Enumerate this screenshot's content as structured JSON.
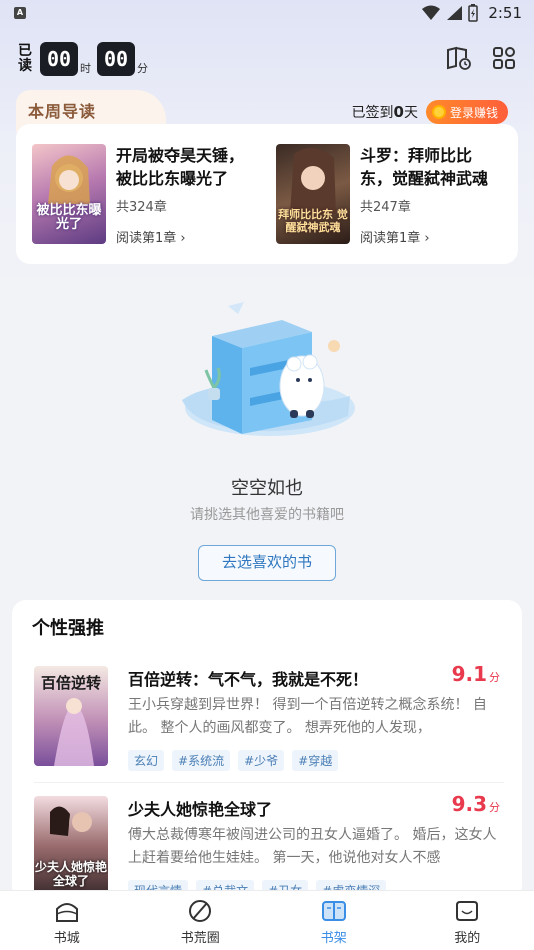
{
  "status": {
    "time": "2:51",
    "app_glyph": "A"
  },
  "timer": {
    "label": "已读",
    "hours": "00",
    "hours_unit": "时",
    "minutes": "00",
    "minutes_unit": "分"
  },
  "weekly": {
    "tab_label": "本周导读",
    "checkin_prefix": "已签到",
    "checkin_days": "0",
    "checkin_suffix": "天",
    "earn_label": "登录赚钱",
    "books": [
      {
        "title": "开局被夺昊天锤，被比比东曝光了",
        "count": "共324章",
        "read": "阅读第1章",
        "cover_text": "被比比东曝光了"
      },
      {
        "title": "斗罗：拜师比比东，觉醒弑神武魂",
        "count": "共247章",
        "read": "阅读第1章",
        "cover_text": "拜师比比东 觉醒弑神武魂"
      }
    ]
  },
  "empty": {
    "title": "空空如也",
    "subtitle": "请挑选其他喜爱的书籍吧",
    "button": "去选喜欢的书"
  },
  "recommend": {
    "title": "个性强推",
    "score_unit": "分",
    "items": [
      {
        "name": "百倍逆转：气不气，我就是不死！",
        "score": "9.1",
        "desc": "王小兵穿越到异世界！ 得到一个百倍逆转之概念系统！ 自此。 整个人的画风都变了。 想弄死他的人发现，",
        "tags": [
          "玄幻",
          "#系统流",
          "#少爷",
          "#穿越"
        ],
        "cover_text": "百倍逆转"
      },
      {
        "name": "少夫人她惊艳全球了",
        "score": "9.3",
        "desc": "傅大总裁傅寒年被闯进公司的丑女人逼婚了。 婚后，这女人上赶着要给他生娃娃。 第一天，他说他对女人不感",
        "tags": [
          "现代言情",
          "#总裁文",
          "#丑女",
          "#虐恋情深"
        ],
        "cover_text": "少夫人她惊艳全球了"
      }
    ]
  },
  "nav": {
    "items": [
      {
        "label": "书城",
        "icon": "house-icon"
      },
      {
        "label": "书荒圈",
        "icon": "compass-icon"
      },
      {
        "label": "书架",
        "icon": "bookshelf-icon",
        "active": true
      },
      {
        "label": "我的",
        "icon": "profile-icon"
      }
    ]
  },
  "colors": {
    "accent": "#3a8ee6",
    "score": "#e8394d",
    "earn": "#ff6a30"
  }
}
